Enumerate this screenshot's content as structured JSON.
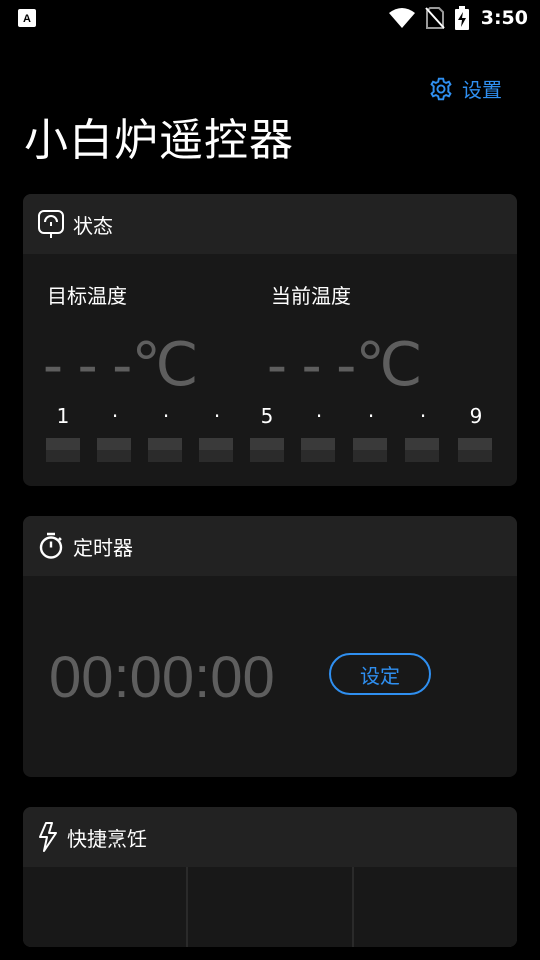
{
  "status_bar": {
    "time": "3:50"
  },
  "header": {
    "settings_label": "设置",
    "title": "小白炉遥控器"
  },
  "status_card": {
    "title": "状态",
    "target_label": "目标温度",
    "current_label": "当前温度",
    "target_value": "- - -℃",
    "current_value": "- - -℃",
    "levels": [
      "1",
      "·",
      "·",
      "·",
      "5",
      "·",
      "·",
      "·",
      "9"
    ]
  },
  "timer_card": {
    "title": "定时器",
    "display": "00:00:00",
    "set_label": "设定"
  },
  "quick_card": {
    "title": "快捷烹饪"
  },
  "colors": {
    "accent": "#2f8ff0",
    "card_bg": "#181818",
    "card_header_bg": "#222222"
  }
}
